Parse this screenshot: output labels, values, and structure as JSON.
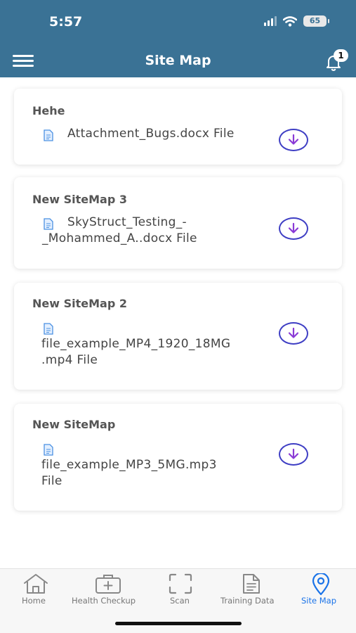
{
  "status_bar": {
    "time": "5:57",
    "battery": "65"
  },
  "header": {
    "title": "Site Map",
    "notification_count": "1"
  },
  "sitemaps": [
    {
      "title": "Hehe",
      "file_line1": "Attachment_Bugs.docx File",
      "file_line2": ""
    },
    {
      "title": "New SiteMap 3",
      "file_line1": "SkyStruct_Testing_-",
      "file_line2": "_Mohammed_A..docx File"
    },
    {
      "title": "New SiteMap 2",
      "file_line1": "file_example_MP4_1920_18MG",
      "file_line2": ".mp4 File"
    },
    {
      "title": "New SiteMap",
      "file_line1": "file_example_MP3_5MG.mp3",
      "file_line2": "File"
    }
  ],
  "tabbar": {
    "items": [
      {
        "label": "Home",
        "icon": "home-icon"
      },
      {
        "label": "Health Checkup",
        "icon": "medical-kit-icon"
      },
      {
        "label": "Scan",
        "icon": "scan-icon"
      },
      {
        "label": "Training Data",
        "icon": "document-icon"
      },
      {
        "label": "Site Map",
        "icon": "location-pin-icon"
      }
    ],
    "active": "Site Map"
  },
  "colors": {
    "header": "#3a7295",
    "download_button": "#3f3fc4",
    "download_arrow": "#8a3ad6",
    "active_tab": "#1a73e8",
    "file_icon": "#4a90e2"
  }
}
